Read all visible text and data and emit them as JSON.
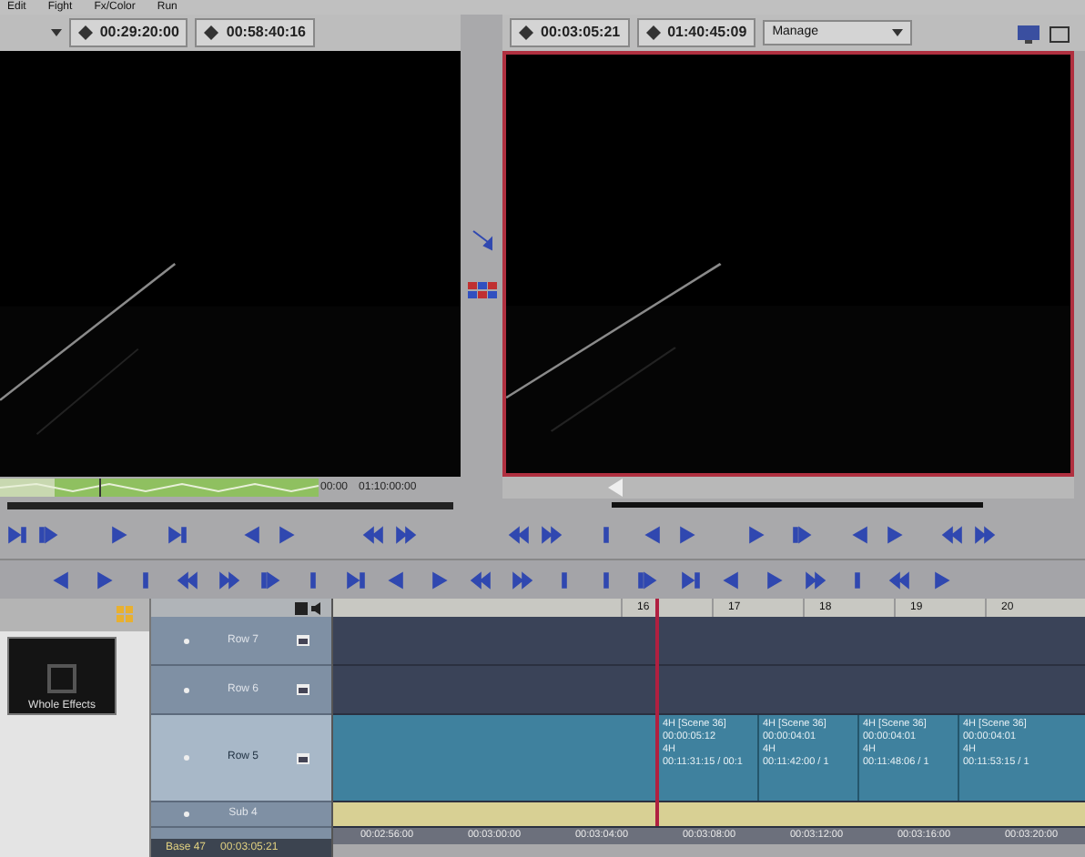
{
  "menu": [
    "Edit",
    "Fight",
    "Fx/Color",
    "Run"
  ],
  "source_viewer": {
    "timecodes": [
      "00:29:20:00",
      "00:58:40:16"
    ],
    "scrub_labels": [
      "00:00",
      "01:10:00:00"
    ]
  },
  "record_viewer": {
    "timecodes": [
      "00:03:05:21",
      "01:40:45:09"
    ],
    "mode": "Manage"
  },
  "bin": {
    "items": [
      {
        "label": "Whole Effects"
      }
    ]
  },
  "timeline": {
    "ruler": [
      "16",
      "17",
      "18",
      "19",
      "20"
    ],
    "tracks": [
      {
        "kind": "video",
        "name": "Row 7",
        "selected": false
      },
      {
        "kind": "video",
        "name": "Row 6",
        "selected": false
      },
      {
        "kind": "video",
        "name": "Row 5",
        "selected": true,
        "clips": [
          {
            "lines": [
              "4H [Scene 36]",
              "00:00:05:12",
              "4H",
              "00:11:31:15 / 00:1"
            ]
          },
          {
            "lines": [
              "4H [Scene 36]",
              "00:00:04:01",
              "4H",
              "00:11:42:00 / 1"
            ]
          },
          {
            "lines": [
              "4H [Scene 36]",
              "00:00:04:01",
              "4H",
              "00:11:48:06 / 1"
            ]
          },
          {
            "lines": [
              "4H [Scene 36]",
              "00:00:04:01",
              "4H",
              "00:11:53:15 / 1"
            ]
          }
        ]
      },
      {
        "kind": "audio",
        "name": "Sub 4",
        "selected": false
      }
    ],
    "timecodes": [
      "00:02:56:00",
      "00:03:00:00",
      "00:03:04:00",
      "00:03:08:00",
      "00:03:12:00",
      "00:03:16:00",
      "00:03:20:00"
    ],
    "footer": [
      "Base 47",
      "00:03:05:21"
    ]
  }
}
